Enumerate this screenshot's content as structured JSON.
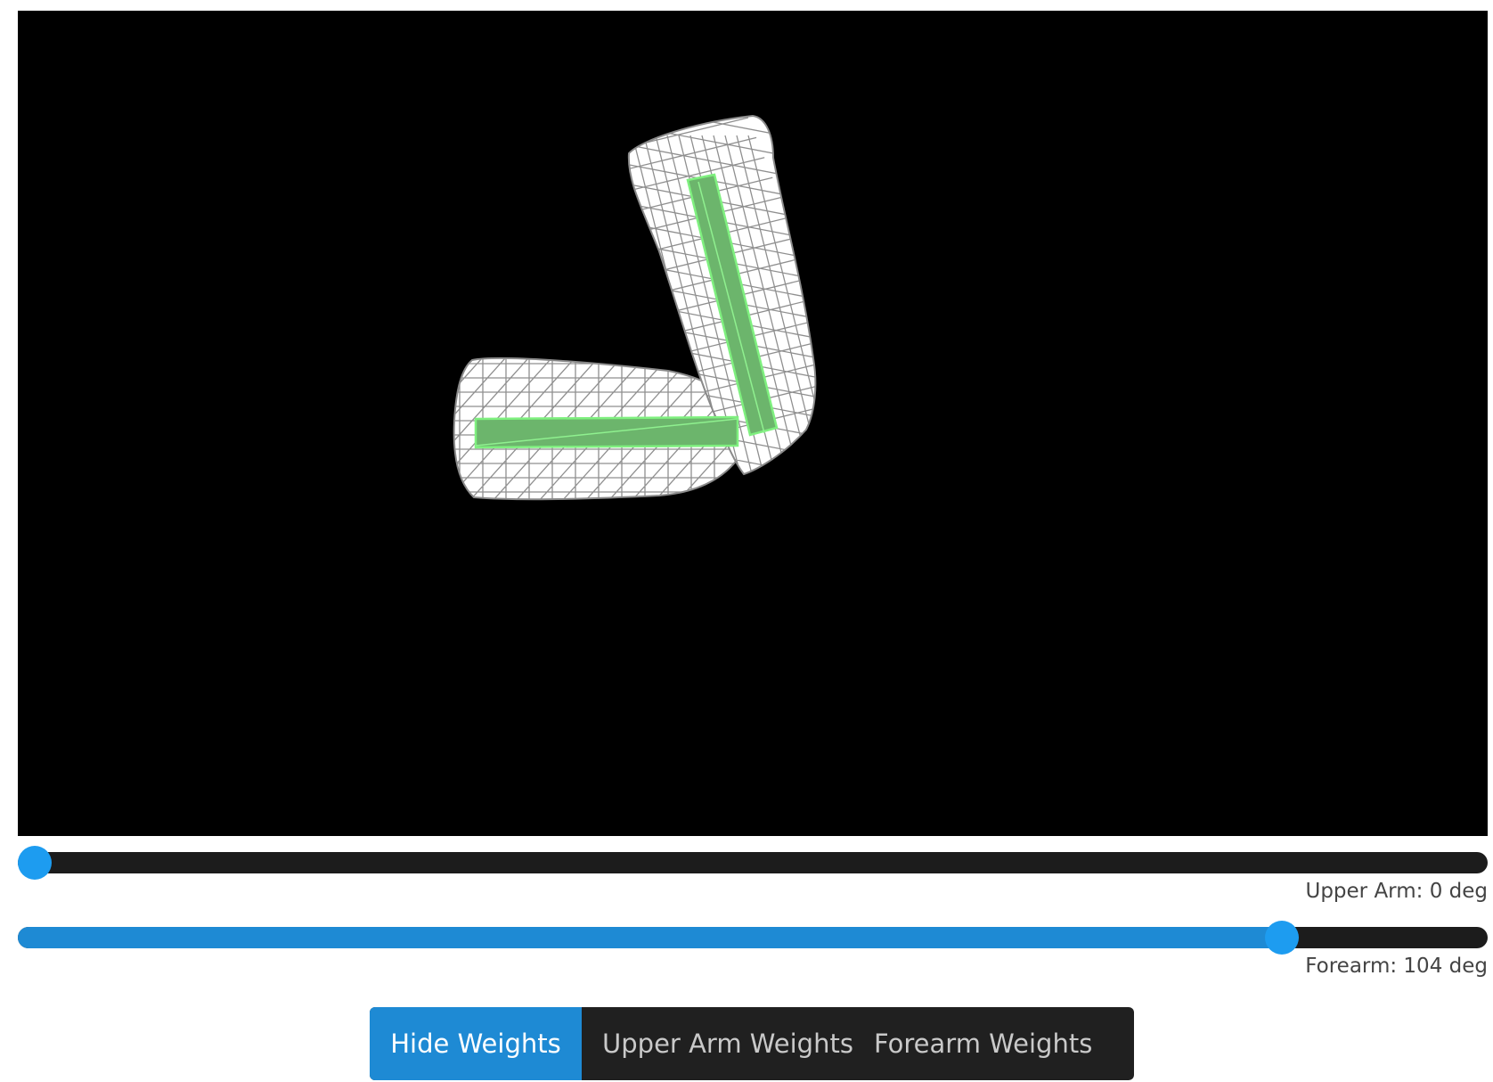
{
  "viewport": {
    "background": "#000000",
    "mesh_color": "#9a9a9a",
    "bone_color": "#6cb56c",
    "bone_outline_color": "#7ff07f"
  },
  "controls": {
    "upper_arm": {
      "label": "Upper Arm: 0 deg",
      "value_fraction": 0.0,
      "fill_color": "#1e8ad4"
    },
    "forearm": {
      "label": "Forearm: 104 deg",
      "value_fraction": 0.86,
      "fill_color": "#1e8ad4"
    }
  },
  "buttons": {
    "hide_weights": "Hide Weights",
    "upper_arm_weights": "Upper Arm Weights",
    "forearm_weights": "Forearm Weights",
    "active": "hide_weights",
    "active_color": "#1e8ad4",
    "inactive_color": "#202020"
  }
}
